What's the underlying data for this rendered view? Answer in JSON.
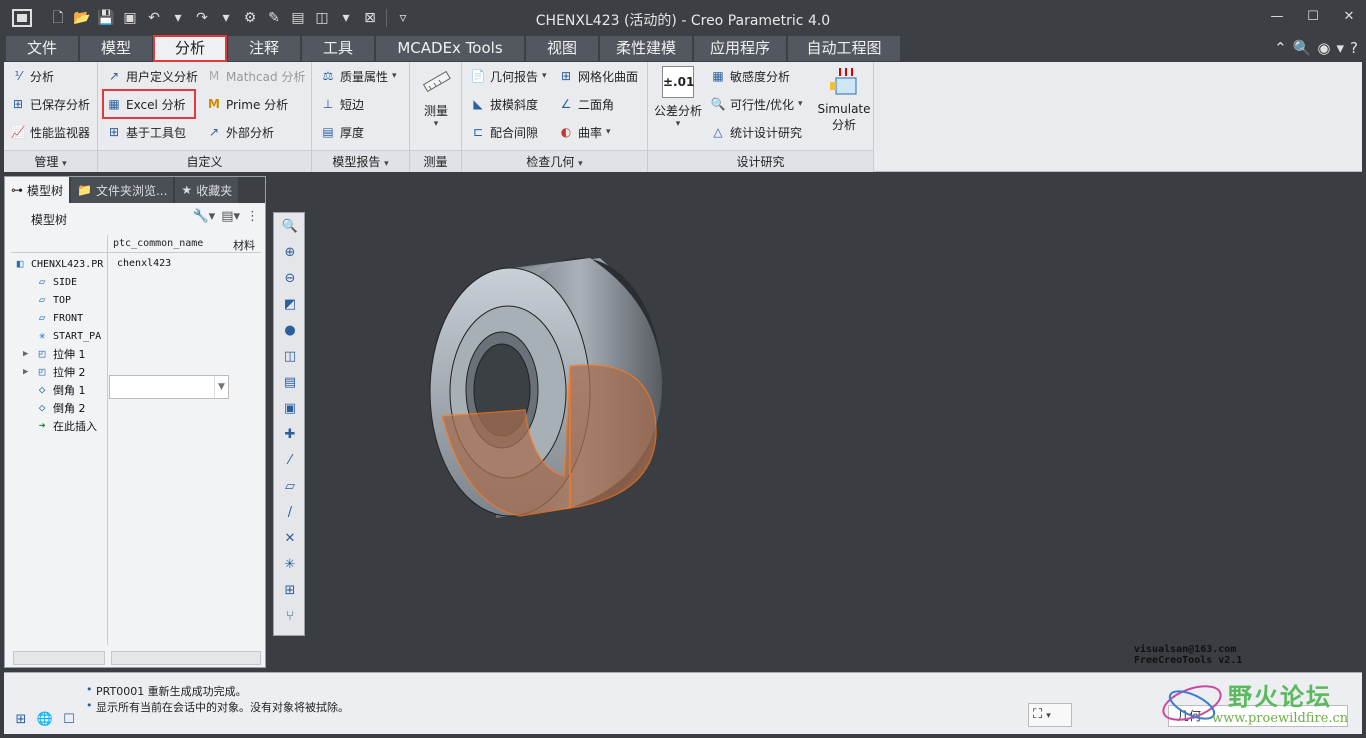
{
  "window": {
    "title": "CHENXL423 (活动的) - Creo Parametric 4.0"
  },
  "tabs": [
    "文件",
    "模型",
    "分析",
    "注释",
    "工具",
    "MCADEx Tools",
    "视图",
    "柔性建模",
    "应用程序",
    "自动工程图"
  ],
  "active_tab": "分析",
  "ribbon": {
    "manage": {
      "label": "管理",
      "items": [
        "分析",
        "已保存分析",
        "性能监视器"
      ]
    },
    "custom": {
      "label": "自定义",
      "items": [
        "用户定义分析",
        "Mathcad 分析",
        "Excel 分析",
        "Prime 分析",
        "基于工具包",
        "外部分析"
      ]
    },
    "model_report": {
      "label": "模型报告",
      "items": [
        "质量属性",
        "短边",
        "厚度"
      ]
    },
    "measure": {
      "label": "测量",
      "button": "测量"
    },
    "inspect": {
      "label": "检查几何",
      "items": [
        "几何报告",
        "网格化曲面",
        "拔模斜度",
        "二面角",
        "配合间隙",
        "曲率"
      ]
    },
    "design_study": {
      "label": "设计研究",
      "items": [
        "公差分析",
        "敏感度分析",
        "可行性/优化",
        "统计设计研究"
      ],
      "simulate": [
        "Simulate",
        "分析"
      ]
    }
  },
  "left_panel": {
    "tabs": [
      "模型树",
      "文件夹浏览...",
      "收藏夹"
    ],
    "tree_title": "模型树",
    "columns": [
      "ptc_common_name",
      "材料"
    ],
    "root": {
      "name": "CHENXL423.PR",
      "value": "chenxl423"
    },
    "items": [
      "SIDE",
      "TOP",
      "FRONT",
      "START_PA",
      "拉伸 1",
      "拉伸 2",
      "倒角 1",
      "倒角 2",
      "在此插入"
    ]
  },
  "graphics": {
    "watermark": [
      "visualsan@163.com",
      "FreeCreoTools v2.1"
    ]
  },
  "status": {
    "messages": [
      "PRT0001 重新生成成功完成。",
      "显示所有当前在会话中的对象。没有对象将被拭除。"
    ],
    "selection_filter": "几何",
    "logo": {
      "title": "野火论坛",
      "url": "www.proewildfire.cn"
    }
  }
}
